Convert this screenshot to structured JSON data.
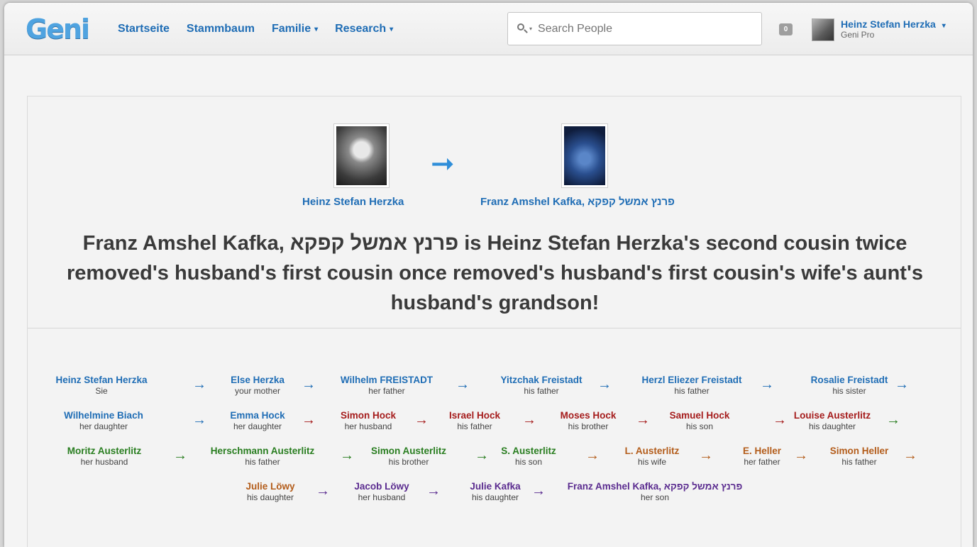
{
  "header": {
    "logo": "Geni",
    "nav": [
      {
        "label": "Startseite",
        "caret": false
      },
      {
        "label": "Stammbaum",
        "caret": false
      },
      {
        "label": "Familie",
        "caret": true
      },
      {
        "label": "Research",
        "caret": true
      }
    ],
    "search_placeholder": "Search People",
    "notification_count": "0",
    "user_name": "Heinz Stefan Herzka",
    "user_plan": "Geni Pro"
  },
  "relationship": {
    "from_name": "Heinz Stefan Herzka",
    "to_name": "Franz Amshel Kafka, פרנץ אמשל קפקא",
    "headline": "Franz Amshel Kafka, פרנץ אמשל קפקא is Heinz Stefan Herzka's second cousin twice removed's husband's first cousin once removed's husband's first cousin's wife's aunt's husband's grandson!"
  },
  "chain": [
    {
      "name": "Heinz Stefan Herzka",
      "rel": "Sie",
      "color": "blue"
    },
    {
      "name": "Else Herzka",
      "rel": "your mother",
      "color": "blue"
    },
    {
      "name": "Wilhelm FREISTADT",
      "rel": "her father",
      "color": "blue"
    },
    {
      "name": "Yitzchak Freistadt",
      "rel": "his father",
      "color": "blue"
    },
    {
      "name": "Herzl Eliezer Freistadt",
      "rel": "his father",
      "color": "blue"
    },
    {
      "name": "Rosalie Freistadt",
      "rel": "his sister",
      "color": "blue"
    },
    {
      "name": "Wilhelmine Biach",
      "rel": "her daughter",
      "color": "blue"
    },
    {
      "name": "Emma Hock",
      "rel": "her daughter",
      "color": "blue"
    },
    {
      "name": "Simon Hock",
      "rel": "her husband",
      "color": "red"
    },
    {
      "name": "Israel Hock",
      "rel": "his father",
      "color": "red"
    },
    {
      "name": "Moses Hock",
      "rel": "his brother",
      "color": "red"
    },
    {
      "name": "Samuel Hock",
      "rel": "his son",
      "color": "red"
    },
    {
      "name": "Louise Austerlitz",
      "rel": "his daughter",
      "color": "red"
    },
    {
      "name": "Moritz Austerlitz",
      "rel": "her husband",
      "color": "green"
    },
    {
      "name": "Herschmann Austerlitz",
      "rel": "his father",
      "color": "green"
    },
    {
      "name": "Simon Austerlitz",
      "rel": "his brother",
      "color": "green"
    },
    {
      "name": "S. Austerlitz",
      "rel": "his son",
      "color": "green"
    },
    {
      "name": "L. Austerlitz",
      "rel": "his wife",
      "color": "orange"
    },
    {
      "name": "E. Heller",
      "rel": "her father",
      "color": "orange"
    },
    {
      "name": "Simon Heller",
      "rel": "his father",
      "color": "orange"
    },
    {
      "name": "Julie Löwy",
      "rel": "his daughter",
      "color": "orange"
    },
    {
      "name": "Jacob Löwy",
      "rel": "her husband",
      "color": "purple"
    },
    {
      "name": "Julie Kafka",
      "rel": "his daughter",
      "color": "purple"
    },
    {
      "name": "Franz Amshel Kafka, פרנץ אמשל קפקא",
      "rel": "her son",
      "color": "purple"
    }
  ],
  "arrows": [
    "blue",
    "blue",
    "blue",
    "blue",
    "blue",
    "blue",
    "blue",
    "red",
    "red",
    "red",
    "red",
    "red",
    "green",
    "green",
    "green",
    "green",
    "orange",
    "orange",
    "orange",
    "orange",
    "purple",
    "purple",
    "purple"
  ]
}
